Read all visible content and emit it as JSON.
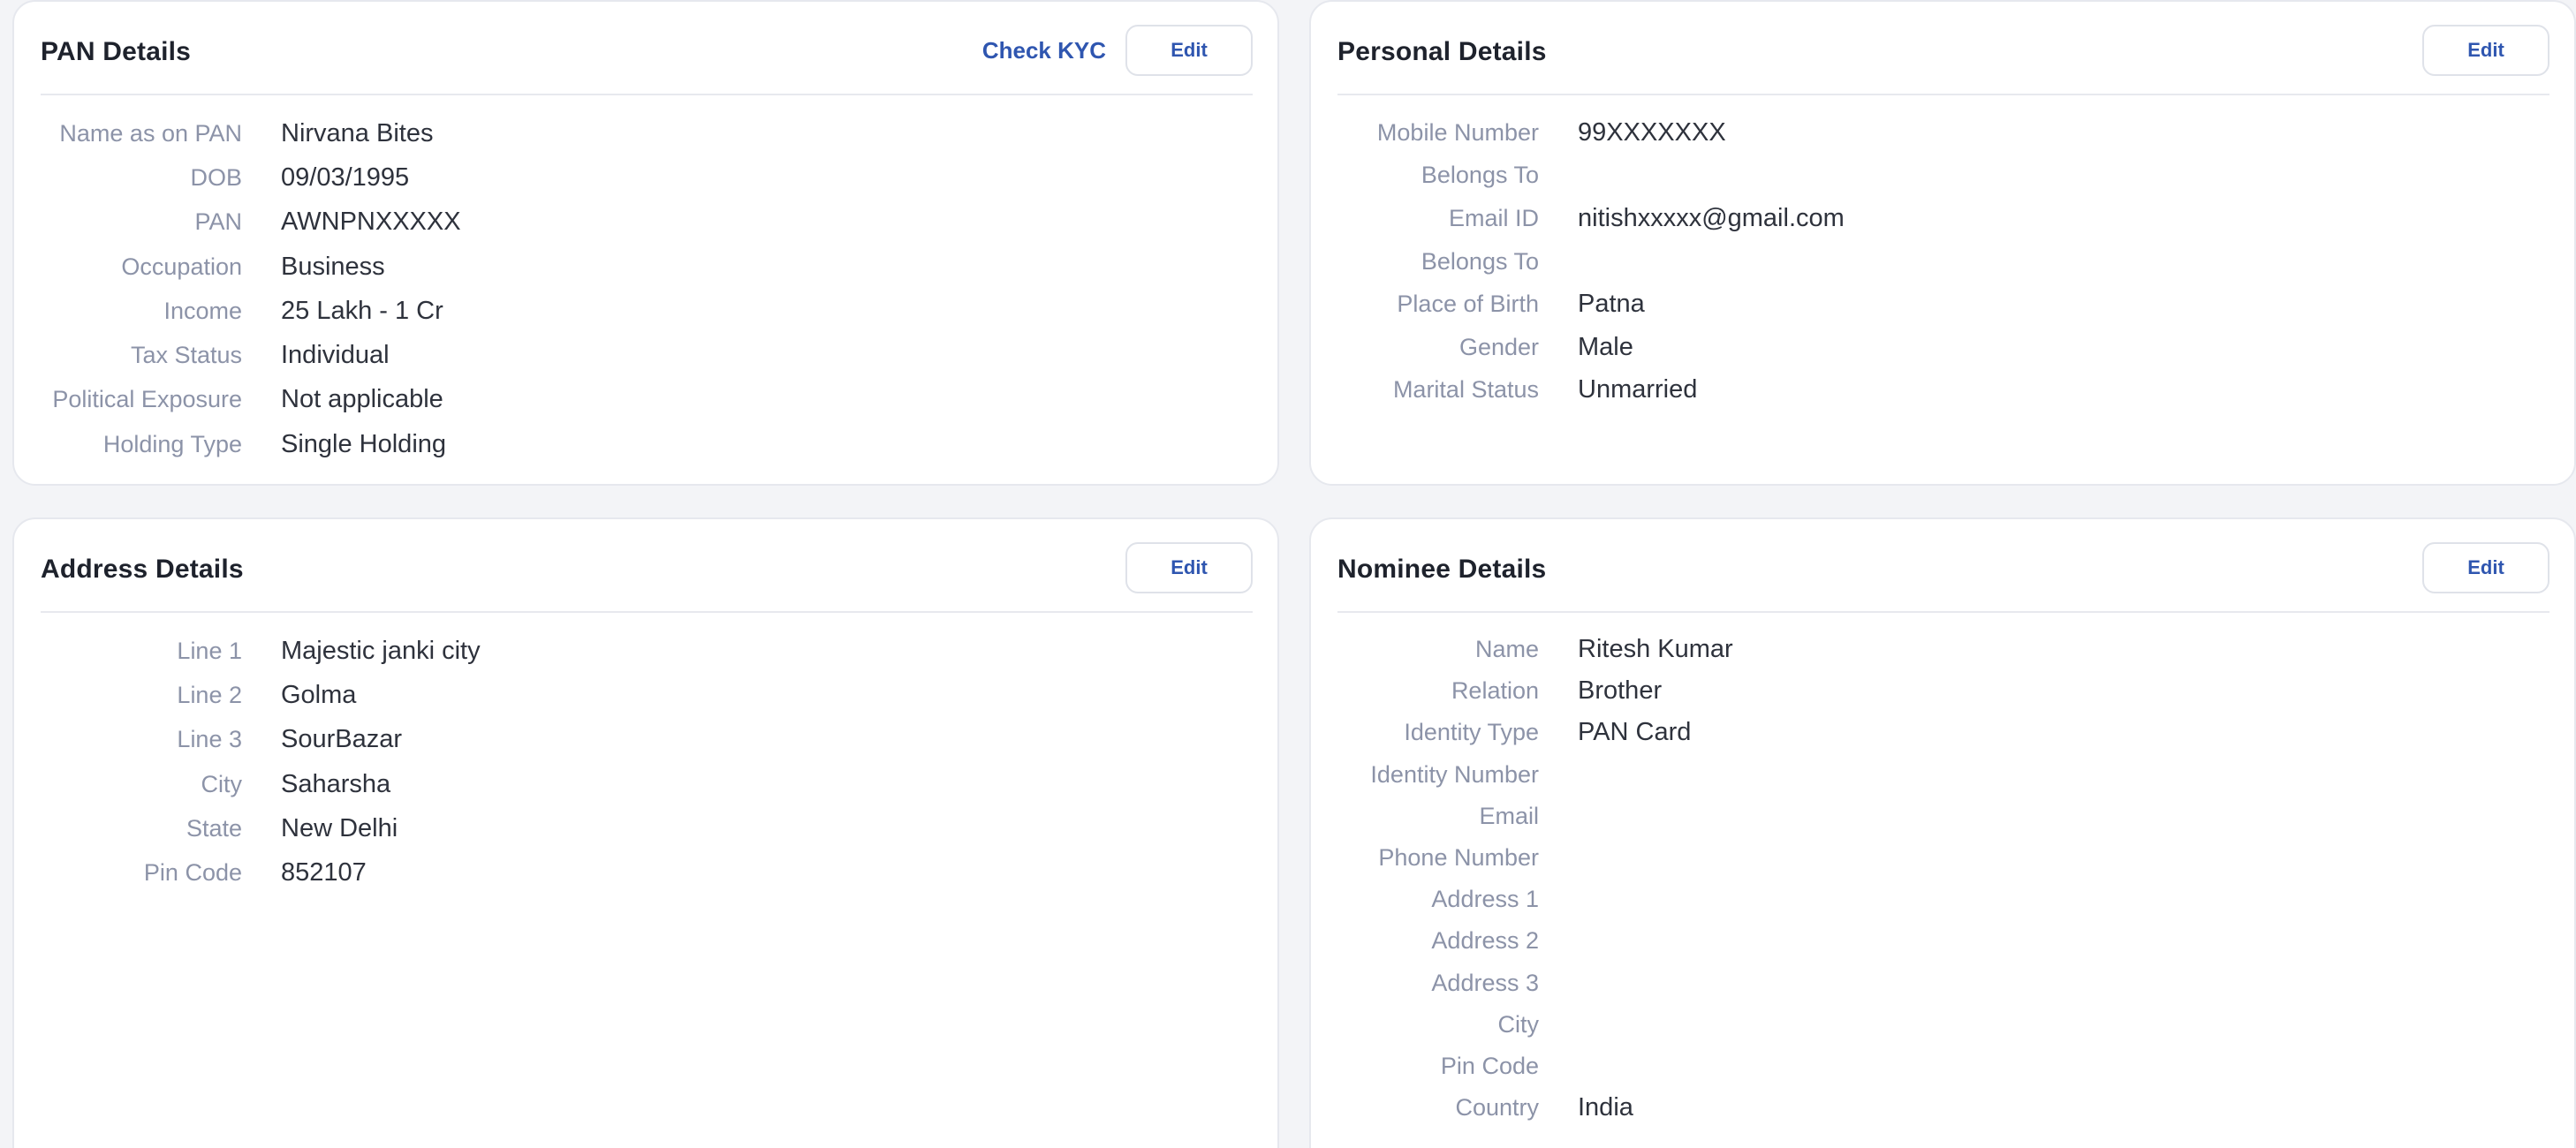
{
  "pan": {
    "title": "PAN Details",
    "check_kyc": "Check KYC",
    "edit": "Edit",
    "rows": [
      {
        "label": "Name as on PAN",
        "value": "Nirvana Bites"
      },
      {
        "label": "DOB",
        "value": "09/03/1995"
      },
      {
        "label": "PAN",
        "value": "AWNPNXXXXX"
      },
      {
        "label": "Occupation",
        "value": "Business"
      },
      {
        "label": "Income",
        "value": "25 Lakh - 1 Cr"
      },
      {
        "label": "Tax Status",
        "value": "Individual"
      },
      {
        "label": "Political Exposure",
        "value": "Not applicable"
      },
      {
        "label": "Holding Type",
        "value": "Single Holding"
      }
    ]
  },
  "personal": {
    "title": "Personal Details",
    "edit": "Edit",
    "rows": [
      {
        "label": "Mobile Number",
        "value": "99XXXXXXX"
      },
      {
        "label": "Belongs To",
        "value": ""
      },
      {
        "label": "Email ID",
        "value": "nitishxxxxx@gmail.com"
      },
      {
        "label": "Belongs To",
        "value": ""
      },
      {
        "label": "Place of Birth",
        "value": "Patna"
      },
      {
        "label": "Gender",
        "value": "Male"
      },
      {
        "label": "Marital Status",
        "value": "Unmarried"
      }
    ]
  },
  "address": {
    "title": "Address Details",
    "edit": "Edit",
    "rows": [
      {
        "label": "Line 1",
        "value": "Majestic janki city"
      },
      {
        "label": "Line 2",
        "value": "Golma"
      },
      {
        "label": "Line 3",
        "value": "SourBazar"
      },
      {
        "label": "City",
        "value": "Saharsha"
      },
      {
        "label": "State",
        "value": "New Delhi"
      },
      {
        "label": "Pin Code",
        "value": "852107"
      }
    ]
  },
  "nominee": {
    "title": "Nominee Details",
    "edit": "Edit",
    "rows": [
      {
        "label": "Name",
        "value": "Ritesh Kumar"
      },
      {
        "label": "Relation",
        "value": "Brother"
      },
      {
        "label": "Identity Type",
        "value": "PAN Card"
      },
      {
        "label": "Identity Number",
        "value": ""
      },
      {
        "label": "Email",
        "value": ""
      },
      {
        "label": "Phone Number",
        "value": ""
      },
      {
        "label": "Address 1",
        "value": ""
      },
      {
        "label": "Address 2",
        "value": ""
      },
      {
        "label": "Address 3",
        "value": ""
      },
      {
        "label": "City",
        "value": ""
      },
      {
        "label": "Pin Code",
        "value": ""
      },
      {
        "label": "Country",
        "value": "India"
      }
    ]
  },
  "colors": {
    "accent": "#2f56b0",
    "label": "#8c93a8",
    "value": "#2e323c",
    "background": "#f3f4f7"
  }
}
